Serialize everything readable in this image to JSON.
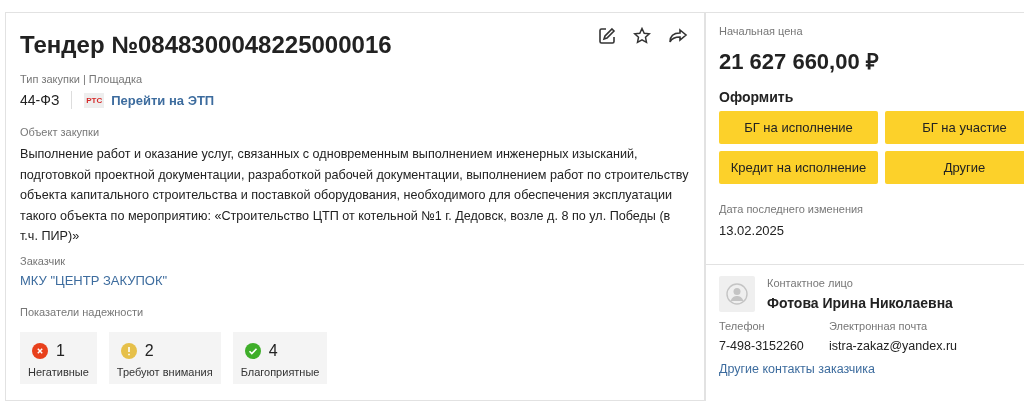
{
  "title": "Тендер №0848300048225000016",
  "actions": [
    {
      "kind": "edit"
    },
    {
      "kind": "star"
    },
    {
      "kind": "share"
    }
  ],
  "procurement": {
    "label": "Тип закупки | Площадка",
    "law": "44-ФЗ",
    "platform_logo": "РТС",
    "platform_link": "Перейти на ЭТП"
  },
  "object": {
    "label": "Объект закупки",
    "text": "Выполнение работ и оказание услуг, связанных с одновременным выполнением инженерных изысканий, подготовкой проектной документации, разработкой рабочей документации, выполнением работ по строительству объекта капитального строительства и поставкой оборудования, необходимого для обеспечения эксплуатации такого объекта по мероприятию: «Строительство ЦТП от котельной №1 г. Дедовск, возле д. 8 по ул. Победы (в т.ч. ПИР)»"
  },
  "customer": {
    "label": "Заказчик",
    "name": "МКУ \"ЦЕНТР ЗАКУПОК\""
  },
  "reliability": {
    "label": "Показатели надежности",
    "items": [
      {
        "kind": "negative",
        "color": "#e8401c",
        "count": "1",
        "label": "Негативные"
      },
      {
        "kind": "warning",
        "color": "#e6c04a",
        "count": "2",
        "label": "Требуют внимания"
      },
      {
        "kind": "positive",
        "color": "#3fae2a",
        "count": "4",
        "label": "Благоприятные"
      }
    ]
  },
  "price": {
    "label": "Начальная цена",
    "value": "21 627 660,00 ₽"
  },
  "apply": {
    "label": "Оформить",
    "buttons": [
      "БГ на исполнение",
      "БГ на участие",
      "Кредит на исполнение",
      "Другие"
    ]
  },
  "last_change": {
    "label": "Дата последнего изменения",
    "date": "13.02.2025"
  },
  "contact": {
    "label": "Контактное лицо",
    "name": "Фотова Ирина Николаевна",
    "phone_label": "Телефон",
    "phone": "7-498-3152260",
    "email_label": "Электронная почта",
    "email": "istra-zakaz@yandex.ru",
    "more_link": "Другие контакты заказчика"
  }
}
